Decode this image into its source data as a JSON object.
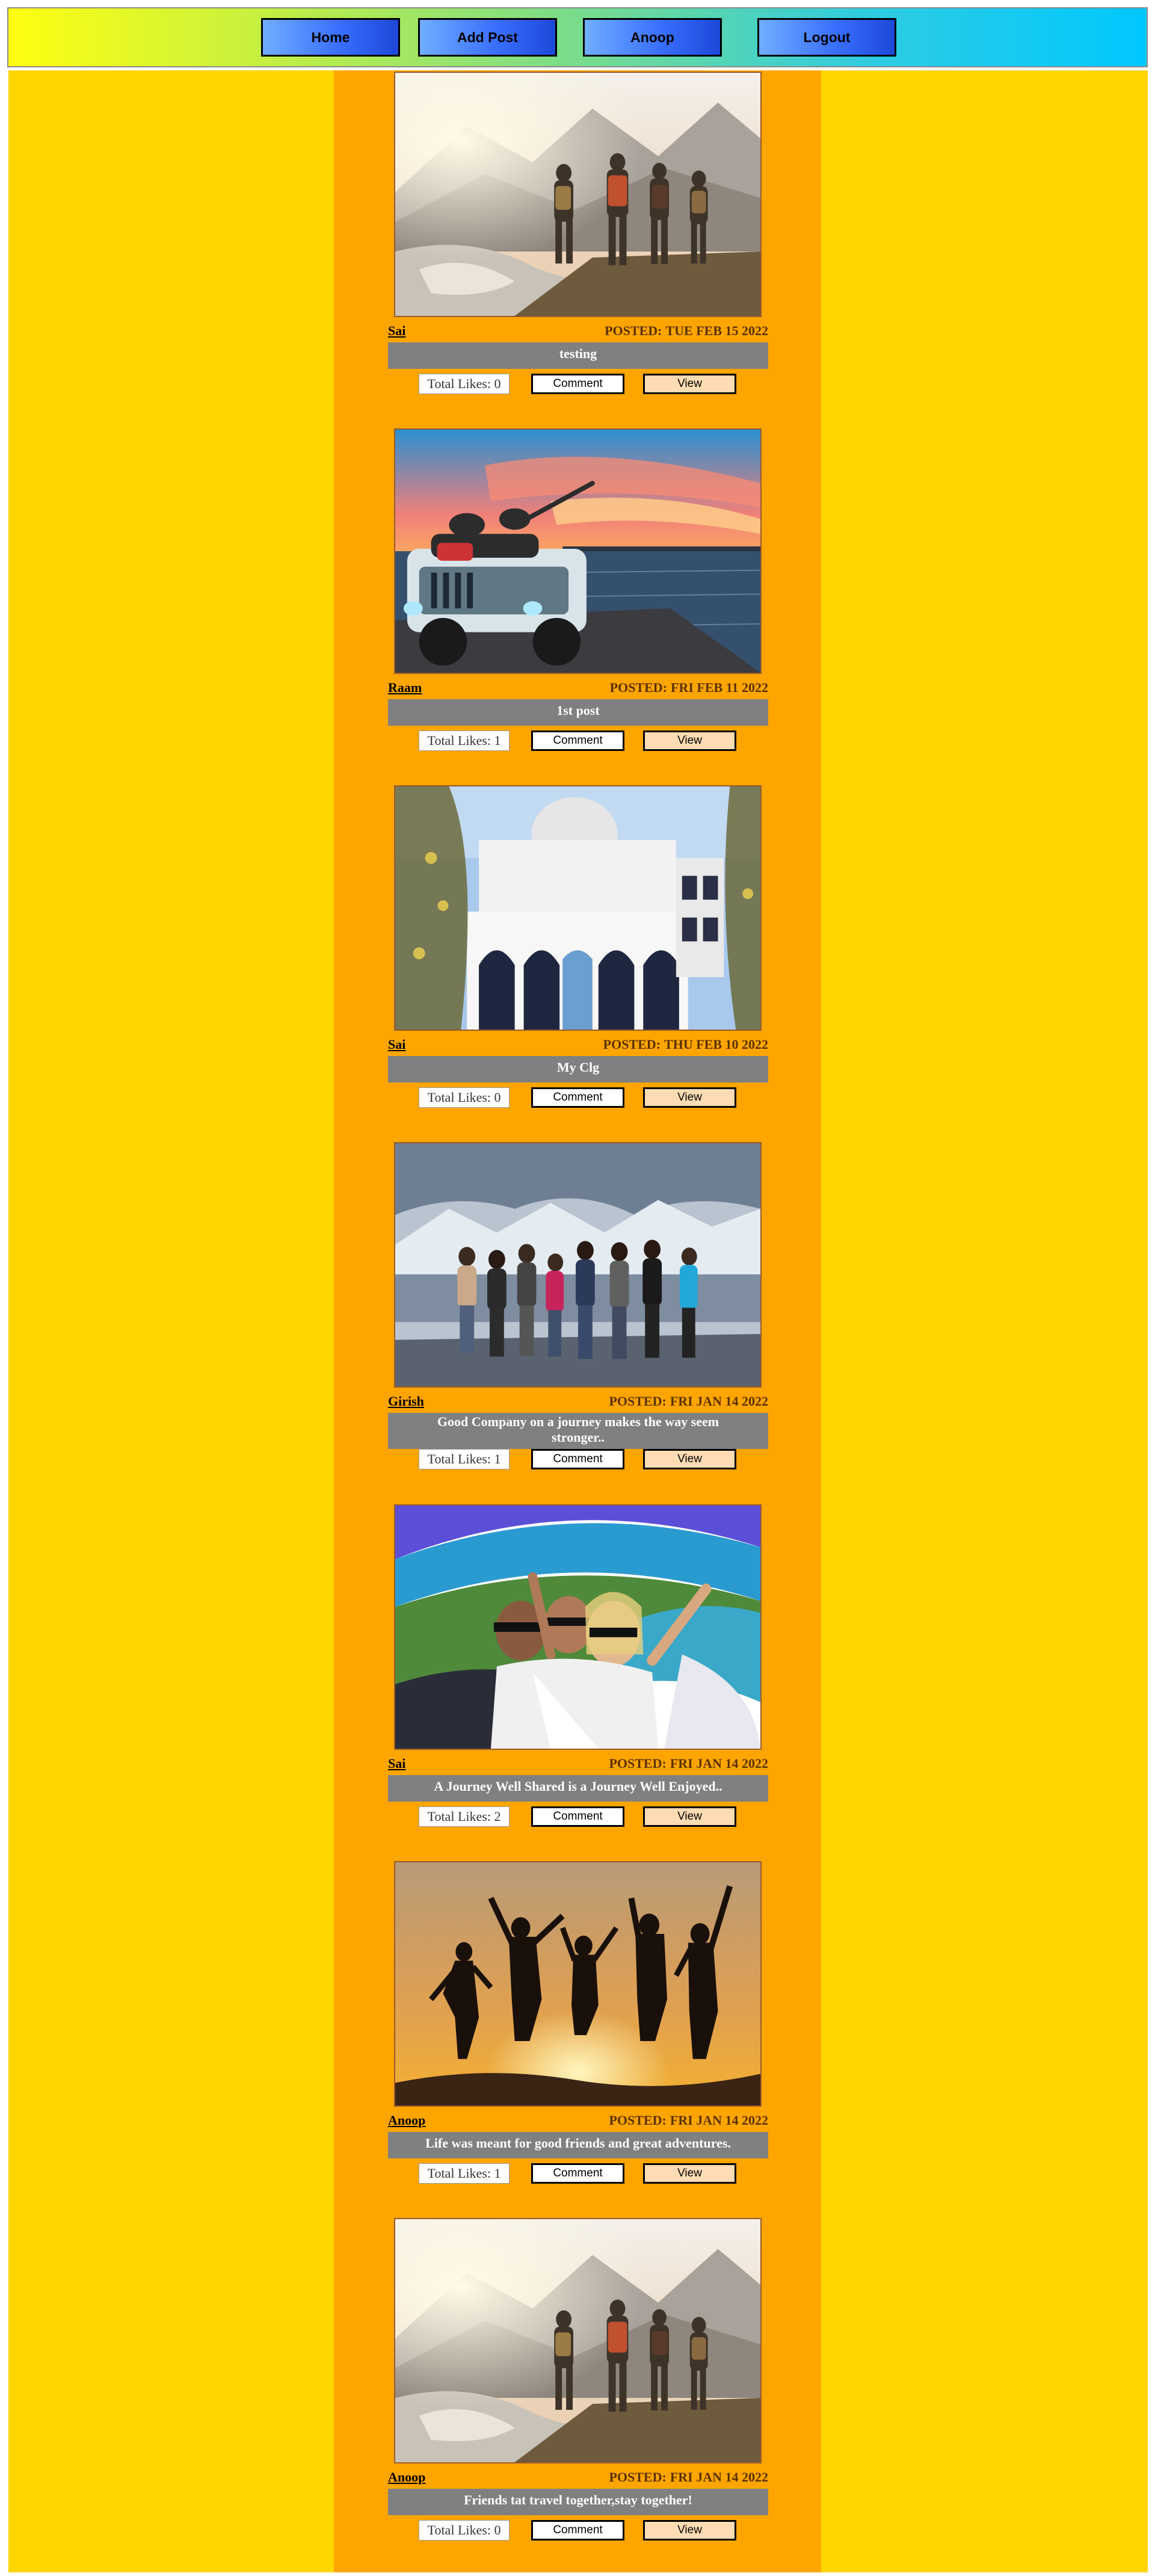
{
  "nav": {
    "home": "Home",
    "add_post": "Add Post",
    "user": "Anoop",
    "logout": "Logout"
  },
  "labels": {
    "posted": "POSTED:",
    "total_likes": "Total Likes:",
    "comment": "Comment",
    "view": "View"
  },
  "posts": [
    {
      "author": "Sai",
      "date": "TUE FEB 15 2022",
      "caption": "testing",
      "likes": "0",
      "image": "hikers-mountain-lake"
    },
    {
      "author": "Raam",
      "date": "FRI FEB 11 2022",
      "caption": "1st post",
      "likes": "1",
      "image": "jeep-sunset-lake"
    },
    {
      "author": "Sai",
      "date": "THU FEB 10 2022",
      "caption": "My Clg",
      "likes": "0",
      "image": "don-bosco-building"
    },
    {
      "author": "Girish",
      "date": "FRI JAN 14 2022",
      "caption": "Good Company on a journey makes the way seem stronger..",
      "likes": "1",
      "image": "group-snowy-mountains"
    },
    {
      "author": "Sai",
      "date": "FRI JAN 14 2022",
      "caption": "A Journey Well Shared is a Journey Well Enjoyed..",
      "likes": "2",
      "image": "selfie-fisheye-coast"
    },
    {
      "author": "Anoop",
      "date": "FRI JAN 14 2022",
      "caption": "Life was meant for good friends and great adventures.",
      "likes": "1",
      "image": "silhouettes-jumping-sunset"
    },
    {
      "author": "Anoop",
      "date": "FRI JAN 14 2022",
      "caption": "Friends tat travel together,stay together!",
      "likes": "0",
      "image": "hikers-mountain-lake"
    }
  ]
}
